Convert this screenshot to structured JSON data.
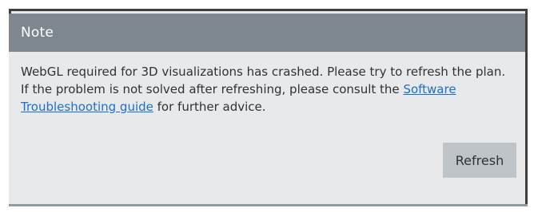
{
  "dialog": {
    "title": "Note",
    "message_part1": "WebGL required for 3D visualizations has crashed. Please try to refresh the plan. If the problem is not solved after refreshing, please consult the ",
    "link_text": "Software Troubleshooting guide",
    "message_part2": " for further advice.",
    "refresh_label": "Refresh"
  },
  "colors": {
    "header_bg": "#7e878f",
    "body_bg": "#e8e9ea",
    "button_bg": "#bfc4c8",
    "link": "#1a6fd0",
    "border": "#3f3f3f"
  }
}
